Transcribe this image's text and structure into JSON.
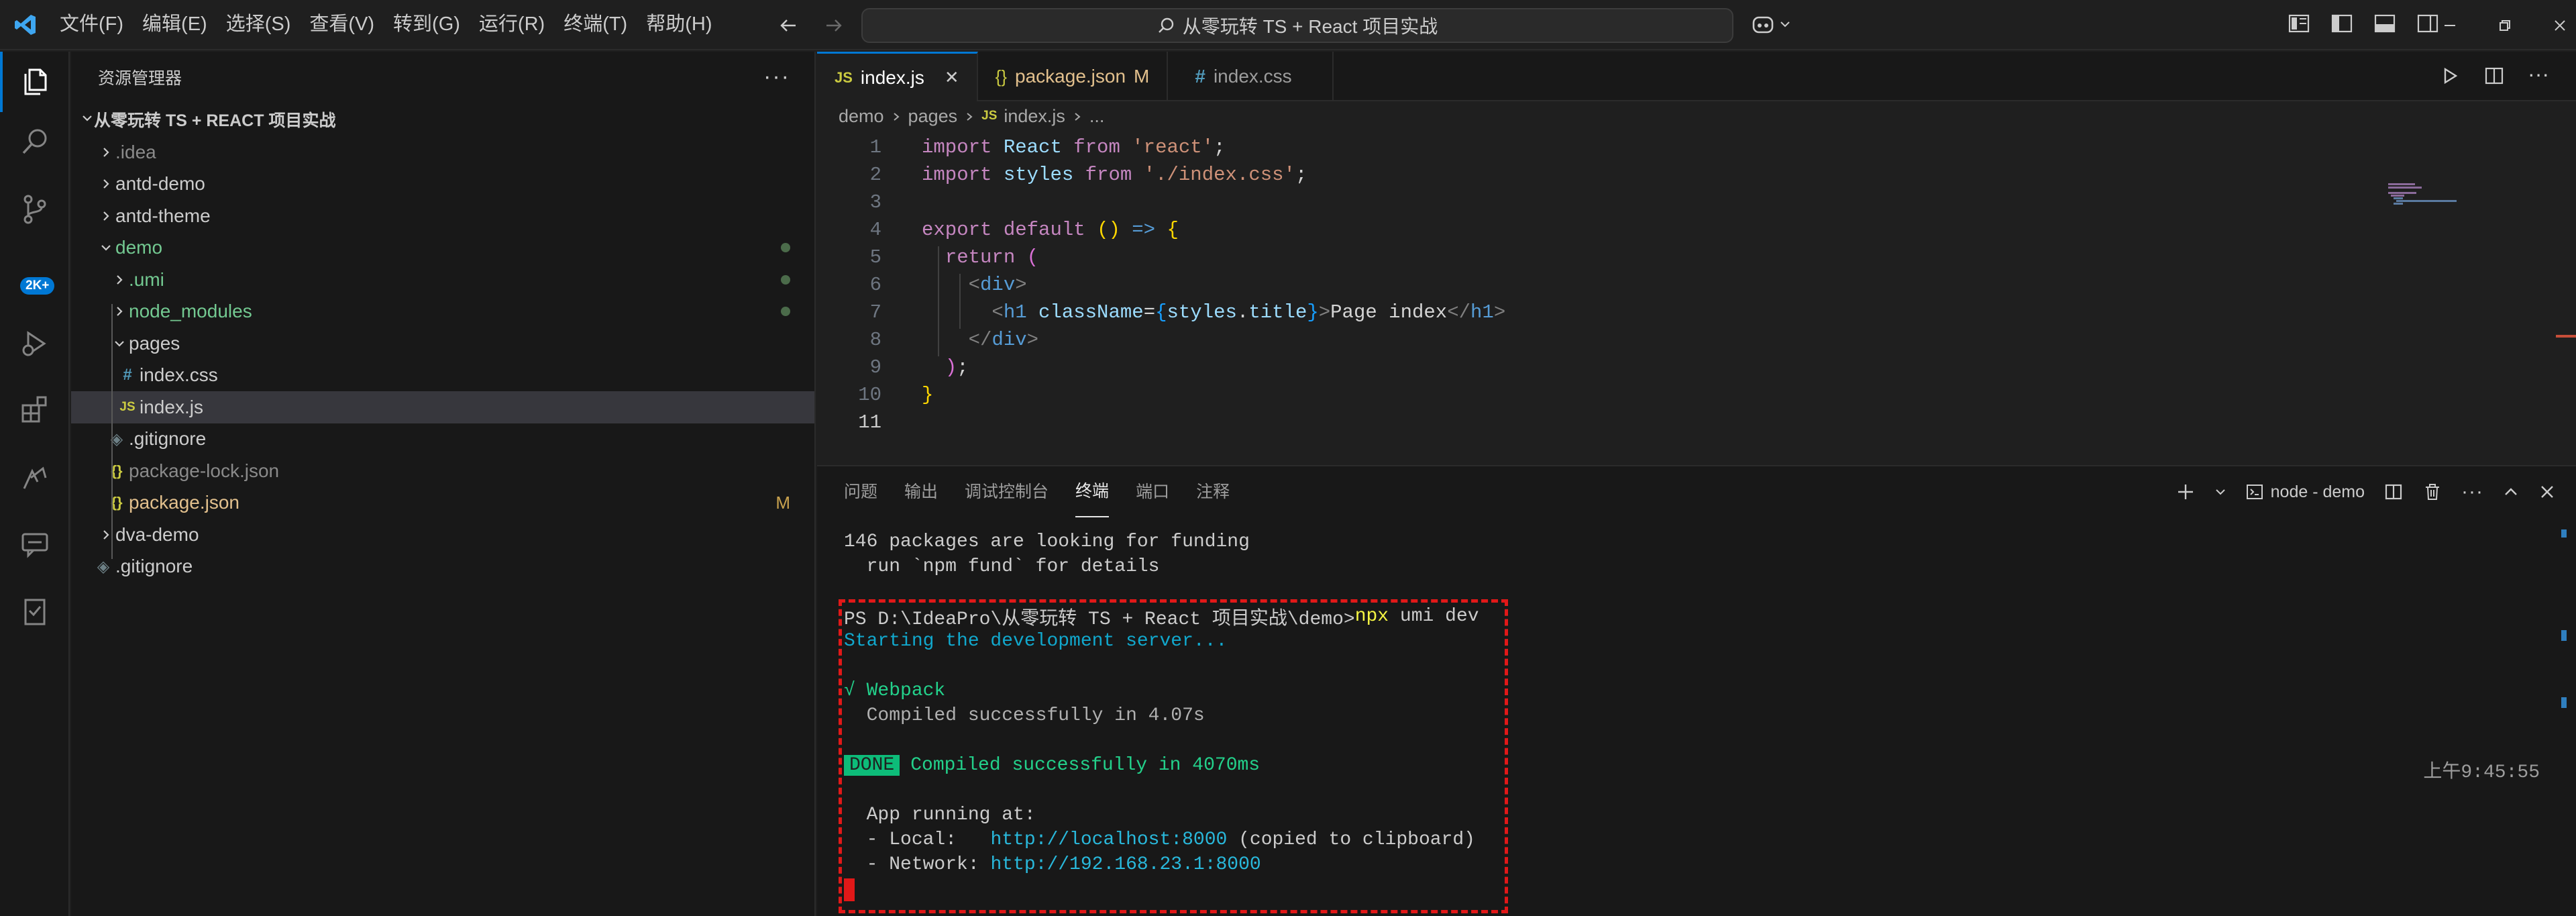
{
  "menubar": {
    "items": [
      "文件(F)",
      "编辑(E)",
      "选择(S)",
      "查看(V)",
      "转到(G)",
      "运行(R)",
      "终端(T)",
      "帮助(H)"
    ],
    "search_text": "从零玩转 TS + React 项目实战"
  },
  "activity_bar": {
    "icons": [
      "explorer-icon",
      "search-icon",
      "source-control-icon",
      "run-debug-icon",
      "extensions-icon",
      "remote-icon",
      "chat-icon",
      "test-icon"
    ],
    "scm_badge": "2K+"
  },
  "sidebar": {
    "title": "资源管理器",
    "more": "···",
    "root": "从零玩转 TS + REACT 项目实战",
    "items": [
      {
        "label": ".idea",
        "type": "folder"
      },
      {
        "label": "antd-demo",
        "type": "folder"
      },
      {
        "label": "antd-theme",
        "type": "folder"
      },
      {
        "label": "demo",
        "type": "folder-open"
      },
      {
        "label": ".umi",
        "type": "folder"
      },
      {
        "label": "node_modules",
        "type": "folder"
      },
      {
        "label": "pages",
        "type": "folder-open"
      },
      {
        "label": "index.css",
        "type": "css"
      },
      {
        "label": "index.js",
        "type": "js"
      },
      {
        "label": ".gitignore",
        "type": "git"
      },
      {
        "label": "package-lock.json",
        "type": "json"
      },
      {
        "label": "package.json",
        "type": "json"
      },
      {
        "label": "dva-demo",
        "type": "folder"
      },
      {
        "label": ".gitignore",
        "type": "git"
      }
    ],
    "modified_flag": "M"
  },
  "editor": {
    "tabs": [
      {
        "icon": "JS",
        "label": "index.js",
        "close": "✕",
        "active": true
      },
      {
        "icon": "{}",
        "label": "package.json",
        "flag": "M"
      },
      {
        "icon": "#",
        "label": "index.css"
      }
    ],
    "breadcrumb": [
      "demo",
      "pages",
      "index.js",
      "..."
    ],
    "breadcrumb_js": "JS",
    "line_numbers": [
      "1",
      "2",
      "3",
      "4",
      "5",
      "6",
      "7",
      "8",
      "9",
      "10",
      "11"
    ],
    "code": {
      "l1": [
        "import",
        "React",
        "from",
        "'react'",
        ";"
      ],
      "l2": [
        "import",
        "styles",
        "from",
        "'./index.css'",
        ";"
      ],
      "l4": [
        "export",
        "default",
        "()",
        "=>",
        "{"
      ],
      "l5": [
        "return",
        "("
      ],
      "l6": [
        "<",
        "div",
        ">"
      ],
      "l7": [
        "<",
        "h1",
        "className",
        "=",
        "{",
        "styles",
        ".",
        "title",
        "}",
        ">",
        "Page index",
        "</",
        "h1",
        ">"
      ],
      "l8": [
        "</",
        "div",
        ">"
      ],
      "l9": [
        ")",
        ";"
      ],
      "l10": [
        "}"
      ]
    }
  },
  "panel": {
    "tabs": [
      "问题",
      "输出",
      "调试控制台",
      "终端",
      "端口",
      "注释"
    ],
    "active_tab": "终端",
    "terminal_name": "node - demo",
    "terminal_lines": {
      "l1": "146 packages are looking for funding",
      "l2": "  run `npm fund` for details",
      "prompt": "PS D:\\IdeaPro\\从零玩转 TS + React 项目实战\\demo>",
      "command": "npx",
      "command_args": " umi dev",
      "starting": "Starting the development server...",
      "check": "√ Webpack",
      "compiled": "  Compiled successfully in 4.07s",
      "done_badge": "DONE",
      "done_text": "Compiled successfully in 4070ms",
      "app_running": "  App running at:",
      "local_label": "  - Local:   ",
      "local_url": "http://localhost:8000",
      "local_note": " (copied to clipboard)",
      "network_label": "  - Network: ",
      "network_url": "http://192.168.23.1:8000"
    },
    "timestamp": "上午9:45:55"
  },
  "colors": {
    "accent": "#0078d4",
    "highlight_box": "#e11818",
    "done_bg": "#0dbc79"
  }
}
